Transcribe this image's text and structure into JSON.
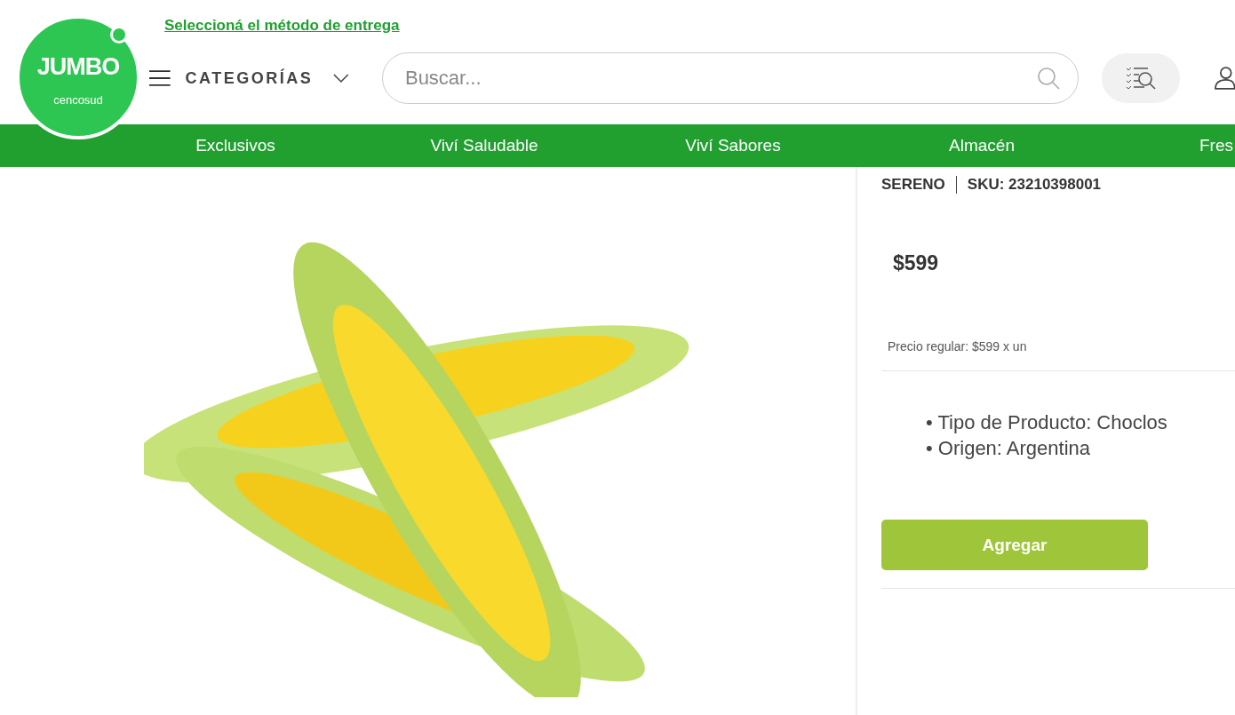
{
  "header": {
    "delivery_link": "Seleccioná el método de entrega",
    "logo": {
      "name": "JUMBO",
      "sub": "cencosud"
    },
    "categories": "CATEGORÍAS",
    "search": {
      "placeholder": "Buscar..."
    }
  },
  "nav": [
    "Exclusivos",
    "Viví Saludable",
    "Viví Sabores",
    "Almacén",
    "Fres"
  ],
  "product": {
    "brand": "SERENO",
    "sku": "SKU: 23210398001",
    "price": "$599",
    "regular_price": "Precio regular: $599 x un",
    "features": [
      "• Tipo de Producto: Choclos",
      "• Origen: Argentina"
    ],
    "add_button": "Agregar"
  }
}
